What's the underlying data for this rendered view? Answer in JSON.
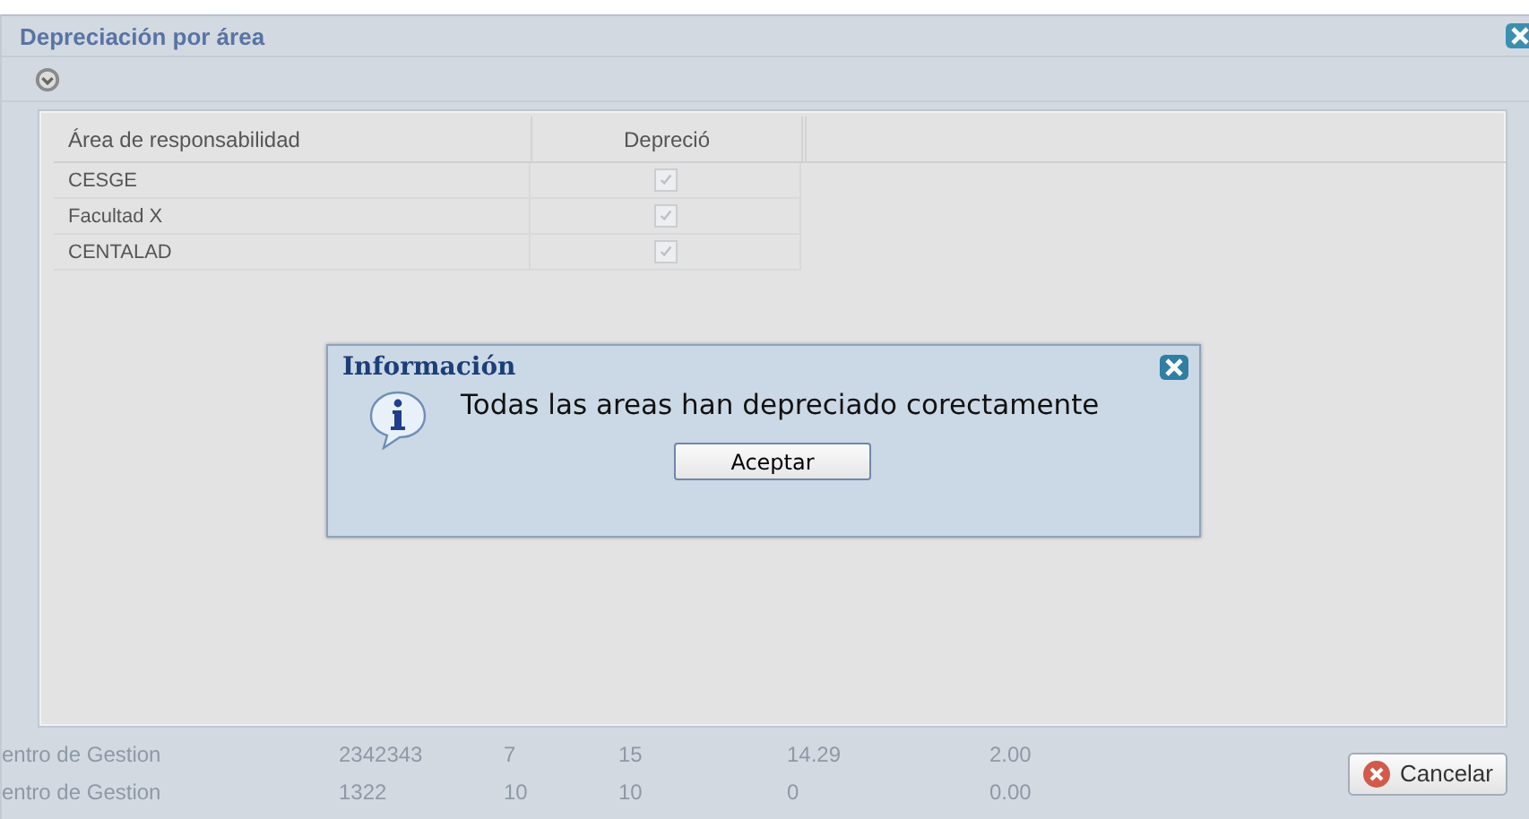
{
  "window": {
    "title": "Depreciación por área"
  },
  "grid": {
    "columns": [
      "Área de responsabilidad",
      "Depreció"
    ],
    "rows": [
      {
        "area": "CESGE",
        "checked": true
      },
      {
        "area": "Facultad X",
        "checked": true
      },
      {
        "area": "CENTALAD",
        "checked": true
      }
    ]
  },
  "dialog": {
    "title": "Información",
    "message": "Todas las areas han depreciado corectamente",
    "button": "Aceptar"
  },
  "background_rows": [
    [
      "entro de Gestion",
      "2342343",
      "7",
      "15",
      "14.29",
      "2.00"
    ],
    [
      "entro de Gestion",
      "1322",
      "10",
      "10",
      "0",
      "0.00"
    ]
  ],
  "footer": {
    "button": "Cancelar"
  }
}
